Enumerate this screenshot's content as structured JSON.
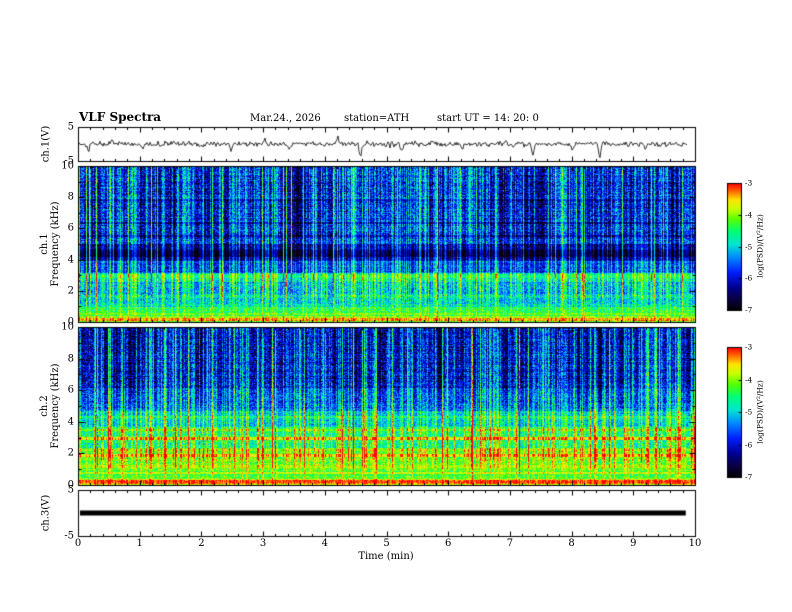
{
  "figure": {
    "title": "VLF Spectra",
    "date": "Mar.24., 2026",
    "station": "station=ATH",
    "start_ut": "start UT =  14: 20: 0",
    "xlabel": "Time (min)",
    "xticks": [
      0,
      1,
      2,
      3,
      4,
      5,
      6,
      7,
      8,
      9,
      10
    ],
    "background": "#ffffff",
    "foreground": "#000000"
  },
  "chart_data": [
    {
      "type": "line",
      "name": "ch1-voltage-waveform",
      "ylabel": "ch.1(V)",
      "ylim": [
        -5,
        5
      ],
      "yticks": [
        5,
        -5
      ],
      "xlim": [
        0,
        10
      ],
      "noise_std_v": 0.5,
      "spikes": [
        {
          "t": 0.15,
          "v": -2.2
        },
        {
          "t": 0.55,
          "v": 1.2
        },
        {
          "t": 1.05,
          "v": -1.6
        },
        {
          "t": 1.55,
          "v": 1.0
        },
        {
          "t": 2.0,
          "v": -1.3
        },
        {
          "t": 2.5,
          "v": -2.0
        },
        {
          "t": 3.05,
          "v": 1.4
        },
        {
          "t": 3.45,
          "v": -1.8
        },
        {
          "t": 4.25,
          "v": 2.2
        },
        {
          "t": 4.62,
          "v": -4.2
        },
        {
          "t": 5.3,
          "v": -2.4
        },
        {
          "t": 5.8,
          "v": 1.3
        },
        {
          "t": 6.3,
          "v": -1.7
        },
        {
          "t": 7.0,
          "v": 1.2
        },
        {
          "t": 7.45,
          "v": -3.2
        },
        {
          "t": 8.1,
          "v": -1.4
        },
        {
          "t": 8.55,
          "v": -3.8
        },
        {
          "t": 9.3,
          "v": -1.6
        }
      ]
    },
    {
      "type": "heatmap",
      "name": "ch1-spectrogram",
      "ylabel_lines": [
        "ch.1",
        "Frequency (kHz)"
      ],
      "ylim": [
        0,
        10
      ],
      "yticks": [
        0,
        2,
        4,
        6,
        8,
        10
      ],
      "xlim": [
        0,
        10
      ],
      "colorscale": {
        "label": "log(PSD)/(V²/Hz)",
        "ticks": [
          -3,
          -4,
          -5,
          -6,
          -7
        ],
        "range": [
          -7,
          -3
        ]
      },
      "bands": [
        {
          "f": [
            0,
            0.35
          ],
          "level": -4.1,
          "noise": 0.45
        },
        {
          "f": [
            0.35,
            0.95
          ],
          "level": -4.6,
          "noise": 0.5
        },
        {
          "f": [
            0.95,
            1.7
          ],
          "level": -5.1,
          "noise": 0.55
        },
        {
          "f": [
            1.7,
            2.55
          ],
          "level": -5.3,
          "noise": 0.55
        },
        {
          "f": [
            2.55,
            3.15
          ],
          "level": -4.95,
          "noise": 0.5
        },
        {
          "f": [
            3.15,
            3.95
          ],
          "level": -5.9,
          "noise": 0.5
        },
        {
          "f": [
            3.95,
            5.05
          ],
          "level": -6.55,
          "noise": 0.4
        },
        {
          "f": [
            5.05,
            10.01
          ],
          "level": -5.95,
          "noise": 0.65
        }
      ],
      "spectral_lines": [
        {
          "f": 0.14,
          "level": -3.4,
          "width": 0.1
        },
        {
          "f": 0.5,
          "level": -4.1,
          "width": 0.07
        },
        {
          "f": 2.9,
          "level": -4.7,
          "width": 0.09
        },
        {
          "f": 4.4,
          "level": -7.0,
          "width": 0.22
        },
        {
          "f": 5.55,
          "level": -6.6,
          "width": 0.07
        },
        {
          "f": 6.4,
          "level": -6.5,
          "width": 0.07
        },
        {
          "f": 7.9,
          "level": -6.4,
          "width": 0.06
        }
      ],
      "streaks": {
        "density": 0.5,
        "min": 0.4,
        "max": 2.0
      }
    },
    {
      "type": "heatmap",
      "name": "ch2-spectrogram",
      "ylabel_lines": [
        "ch.2",
        "Frequency (kHz)"
      ],
      "ylim": [
        0,
        10
      ],
      "yticks": [
        0,
        2,
        4,
        6,
        8,
        10
      ],
      "xlim": [
        0,
        10
      ],
      "colorscale": {
        "label": "log(PSD)/(V²/Hz)",
        "ticks": [
          -3,
          -4,
          -5,
          -6,
          -7
        ],
        "range": [
          -7,
          -3
        ]
      },
      "bands": [
        {
          "f": [
            0,
            0.35
          ],
          "level": -3.95,
          "noise": 0.4
        },
        {
          "f": [
            0.35,
            1.25
          ],
          "level": -4.35,
          "noise": 0.45
        },
        {
          "f": [
            1.25,
            2.35
          ],
          "level": -4.25,
          "noise": 0.45
        },
        {
          "f": [
            2.35,
            3.7
          ],
          "level": -4.7,
          "noise": 0.5
        },
        {
          "f": [
            3.7,
            4.7
          ],
          "level": -5.1,
          "noise": 0.5
        },
        {
          "f": [
            4.7,
            6.2
          ],
          "level": -5.7,
          "noise": 0.6
        },
        {
          "f": [
            6.2,
            10.01
          ],
          "level": -6.05,
          "noise": 0.65
        }
      ],
      "spectral_lines": [
        {
          "f": 0.16,
          "level": -3.2,
          "width": 0.1
        },
        {
          "f": 0.75,
          "level": -3.8,
          "width": 0.08
        },
        {
          "f": 1.15,
          "level": -3.9,
          "width": 0.07
        },
        {
          "f": 1.85,
          "level": -3.6,
          "width": 0.1
        },
        {
          "f": 2.2,
          "level": -4.0,
          "width": 0.07
        },
        {
          "f": 2.95,
          "level": -3.6,
          "width": 0.09
        },
        {
          "f": 3.5,
          "level": -4.1,
          "width": 0.07
        },
        {
          "f": 4.35,
          "level": -4.6,
          "width": 0.06
        }
      ],
      "streaks": {
        "density": 0.5,
        "min": 0.4,
        "max": 2.0
      }
    },
    {
      "type": "line",
      "name": "ch3-voltage-flatline",
      "ylabel": "ch.3(V)",
      "ylim": [
        -5,
        5
      ],
      "yticks": [
        5,
        -5
      ],
      "xlim": [
        0,
        10
      ],
      "value": 0,
      "t_start": 0.0,
      "t_end": 9.85,
      "thickness_px": 5
    }
  ],
  "colormap_stops": [
    [
      0.0,
      0,
      0,
      0
    ],
    [
      0.08,
      10,
      0,
      60
    ],
    [
      0.18,
      0,
      0,
      140
    ],
    [
      0.3,
      0,
      30,
      255
    ],
    [
      0.42,
      0,
      140,
      255
    ],
    [
      0.52,
      0,
      230,
      210
    ],
    [
      0.62,
      0,
      255,
      120
    ],
    [
      0.72,
      90,
      255,
      0
    ],
    [
      0.8,
      200,
      255,
      0
    ],
    [
      0.87,
      255,
      230,
      0
    ],
    [
      0.93,
      255,
      120,
      0
    ],
    [
      1.0,
      255,
      0,
      0
    ]
  ]
}
